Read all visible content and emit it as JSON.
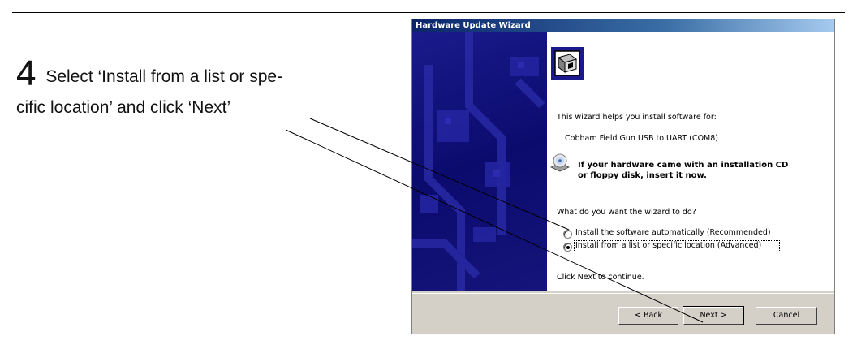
{
  "instruction": {
    "step_number": "4",
    "line1": " Select ‘Install from a list or spe-",
    "line2": "cific location’ and click ‘Next’"
  },
  "wizard": {
    "title": "Hardware Update Wizard",
    "intro": "This wizard helps you install software for:",
    "device_name": "Cobham Field Gun USB to UART (COM8)",
    "cd_notice_line1": "If your hardware came with an installation CD",
    "cd_notice_line2": "or floppy disk, insert it now.",
    "question": "What do you want the wizard to do?",
    "options": [
      {
        "label": "Install the software automatically (Recommended)",
        "selected": false
      },
      {
        "label": "Install from a list or specific location (Advanced)",
        "selected": true
      }
    ],
    "footer_hint": "Click Next to continue.",
    "buttons": {
      "back": "< Back",
      "next": "Next >",
      "cancel": "Cancel"
    }
  },
  "icons": [
    "hardware-icon",
    "cd-icon",
    "radio-unselected",
    "radio-selected"
  ],
  "colors": {
    "titlebar": "#0a246a",
    "side_panel": "#0b0b6e",
    "dialog_face": "#d4d0c8"
  }
}
